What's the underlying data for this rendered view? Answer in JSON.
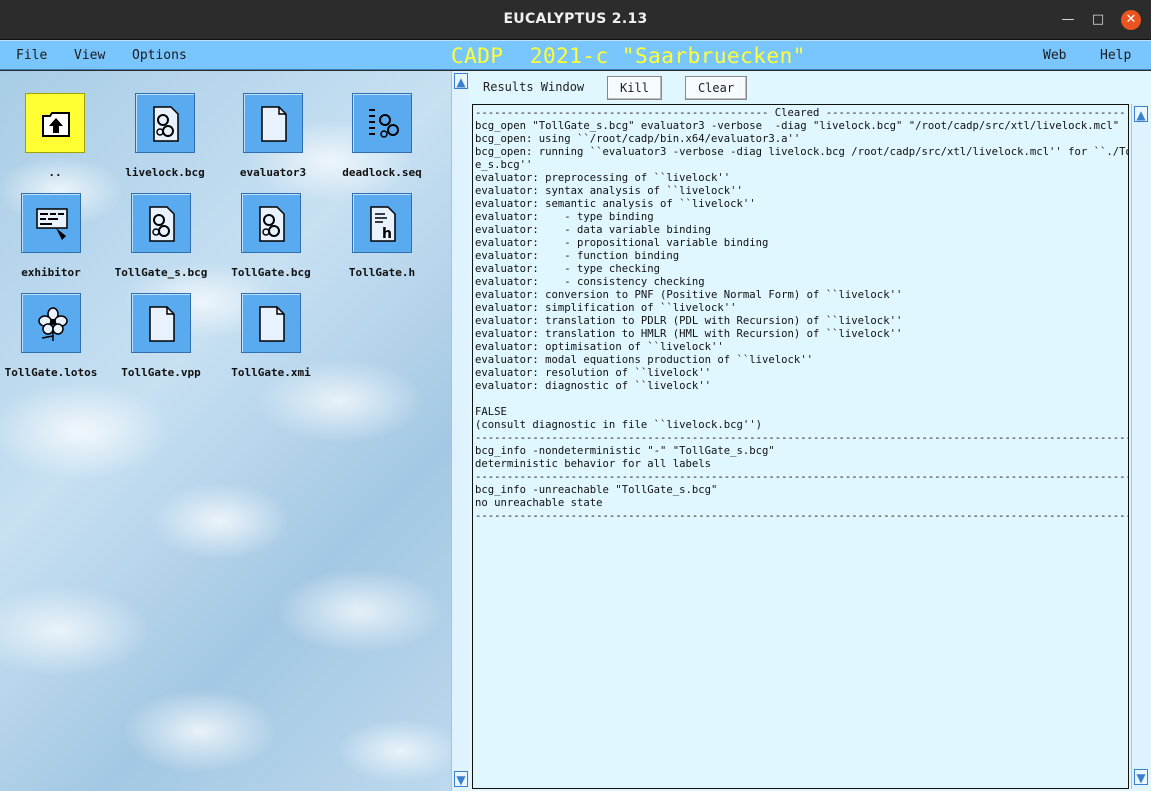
{
  "window": {
    "title": "EUCALYPTUS 2.13",
    "controls": {
      "minimize": "—",
      "maximize": "□",
      "close": "✕"
    }
  },
  "menubar": {
    "left_items": [
      "File",
      "View",
      "Options"
    ],
    "app_title": "CADP  2021-c \"Saarbruecken\"",
    "right_items": [
      "Web",
      "Help"
    ],
    "colors": {
      "bar": "#79c6ff",
      "title": "#ffff33"
    }
  },
  "files": [
    {
      "label": "..",
      "icon": "parent-folder-up-arrow-icon"
    },
    {
      "label": "livelock.bcg",
      "icon": "bcg-gears-file-icon"
    },
    {
      "label": "evaluator3",
      "icon": "blank-file-icon"
    },
    {
      "label": "deadlock.seq",
      "icon": "sequence-gears-file-icon"
    },
    {
      "label": "exhibitor",
      "icon": "exhibitor-tool-icon"
    },
    {
      "label": "TollGate_s.bcg",
      "icon": "bcg-gears-file-icon"
    },
    {
      "label": "TollGate.bcg",
      "icon": "bcg-gears-file-icon"
    },
    {
      "label": "TollGate.h",
      "icon": "header-h-file-icon"
    },
    {
      "label": "TollGate.lotos",
      "icon": "lotos-flower-file-icon"
    },
    {
      "label": "TollGate.vpp",
      "icon": "blank-file-icon"
    },
    {
      "label": "TollGate.xmi",
      "icon": "blank-file-icon"
    }
  ],
  "results": {
    "label": "Results Window",
    "kill_label": "Kill",
    "clear_label": "Clear",
    "log": "---------------------------------------------- Cleared -----------------------------------------------\nbcg_open \"TollGate_s.bcg\" evaluator3 -verbose  -diag \"livelock.bcg\" \"/root/cadp/src/xtl/livelock.mcl\"\nbcg_open: using ``/root/cadp/bin.x64/evaluator3.a''\nbcg_open: running ``evaluator3 -verbose -diag livelock.bcg /root/cadp/src/xtl/livelock.mcl'' for ``./TollGat\ne_s.bcg''\nevaluator: preprocessing of ``livelock''\nevaluator: syntax analysis of ``livelock''\nevaluator: semantic analysis of ``livelock''\nevaluator:    - type binding\nevaluator:    - data variable binding\nevaluator:    - propositional variable binding\nevaluator:    - function binding\nevaluator:    - type checking\nevaluator:    - consistency checking\nevaluator: conversion to PNF (Positive Normal Form) of ``livelock''\nevaluator: simplification of ``livelock''\nevaluator: translation to PDLR (PDL with Recursion) of ``livelock''\nevaluator: translation to HMLR (HML with Recursion) of ``livelock''\nevaluator: optimisation of ``livelock''\nevaluator: modal equations production of ``livelock''\nevaluator: resolution of ``livelock''\nevaluator: diagnostic of ``livelock''\n\nFALSE\n(consult diagnostic in file ``livelock.bcg'')\n--------------------------------------------------------------------------------------------------------\nbcg_info -nondeterministic \"-\" \"TollGate_s.bcg\"\ndeterministic behavior for all labels\n--------------------------------------------------------------------------------------------------------\nbcg_info -unreachable \"TollGate_s.bcg\"\nno unreachable state\n--------------------------------------------------------------------------------------------------------",
    "colors": {
      "background": "#e0f7ff"
    }
  },
  "scroll": {
    "up": "▲",
    "down": "▼"
  }
}
